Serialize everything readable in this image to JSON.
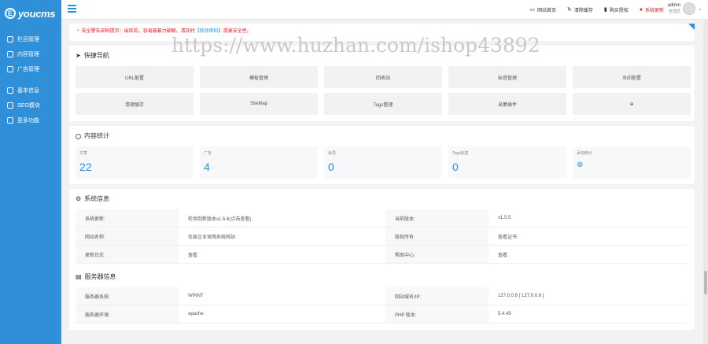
{
  "brand": {
    "mark": "E",
    "name": "youcms"
  },
  "sidebar": {
    "items": [
      {
        "label": "栏目管理",
        "icon": "columns-icon"
      },
      {
        "label": "内容管理",
        "icon": "document-icon"
      },
      {
        "label": "广告管理",
        "icon": "ad-icon"
      }
    ],
    "items2": [
      {
        "label": "基本信息",
        "icon": "settings-icon"
      },
      {
        "label": "SEO模块",
        "icon": "seo-icon"
      },
      {
        "label": "更多功能",
        "icon": "grid-icon"
      }
    ]
  },
  "topbar": {
    "links": [
      {
        "label": "网站首页",
        "icon": "monitor-icon",
        "glyph": "▭"
      },
      {
        "label": "清除缓存",
        "icon": "refresh-icon",
        "glyph": "↻"
      },
      {
        "label": "购买授权",
        "icon": "bookmark-icon",
        "glyph": "▮"
      },
      {
        "label": "系统更新",
        "icon": "alert-icon",
        "glyph": "●"
      }
    ],
    "user": {
      "name": "admin",
      "role": "管理员"
    }
  },
  "notice": {
    "text": "・ 安全警告采码提示：出库前，容易被暴力破解。请及时",
    "link": "【修改密码】",
    "suffix": "提高安全性。"
  },
  "watermark": "https://www.huzhan.com/ishop43892",
  "quick_nav": {
    "title": "快捷导航",
    "buttons": [
      "URL配置",
      "模板管理",
      "回收站",
      "标签管理",
      "水印配置",
      "清理缓存",
      "SiteMap",
      "Tags管理",
      "采集插件",
      "⊕"
    ]
  },
  "stats": {
    "title": "内容统计",
    "items": [
      {
        "label": "文章",
        "value": "22"
      },
      {
        "label": "广告",
        "value": "4"
      },
      {
        "label": "会员",
        "value": "0"
      },
      {
        "label": "Tags标签",
        "value": "0"
      },
      {
        "label": "添加统计",
        "value": "⊕"
      }
    ]
  },
  "system_info": {
    "title": "系统信息",
    "rows": [
      {
        "l1": "系统更新:",
        "v1": "检测到新版本v1.5.6(点击查看)",
        "l2": "当前版本:",
        "v2": "v1.5.5"
      },
      {
        "l1": "网站名称:",
        "v1": "优易企业官网系统网站",
        "l2": "版权所有:",
        "v2": "查看证书"
      },
      {
        "l1": "更新日志:",
        "v1": "查看",
        "l2": "帮助中心:",
        "v2": "查看"
      }
    ]
  },
  "server_info": {
    "title": "服务器信息",
    "rows": [
      {
        "l1": "服务器系统:",
        "v1": "WINNT",
        "l2": "网站域名/IP:",
        "v2": "127.0.0.6 [ 127.0.0.6 ]"
      },
      {
        "l1": "服务器环境:",
        "v1": "apache",
        "l2": "PHP 版本:",
        "v2": "5.4.45"
      }
    ]
  }
}
